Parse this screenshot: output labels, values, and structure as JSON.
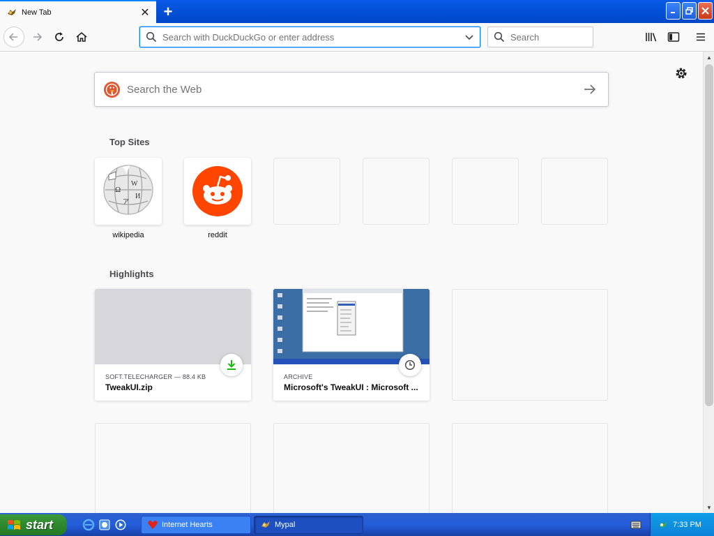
{
  "tab": {
    "title": "New Tab",
    "close_label": "✕",
    "new_tab_label": "+"
  },
  "window_controls": {
    "minimize": "_",
    "maximize": "▣",
    "close": "✕"
  },
  "navbar": {
    "url_placeholder": "Search with DuckDuckGo or enter address",
    "search_placeholder": "Search"
  },
  "newtab": {
    "search_placeholder": "Search the Web",
    "top_sites_title": "Top Sites",
    "top_sites": [
      {
        "label": "wikipedia",
        "icon": "wikipedia-globe-icon"
      },
      {
        "label": "reddit",
        "icon": "reddit-alien-icon"
      },
      {
        "label": ""
      },
      {
        "label": ""
      },
      {
        "label": ""
      },
      {
        "label": ""
      }
    ],
    "highlights_title": "Highlights",
    "highlights": [
      {
        "source": "SOFT.TELECHARGER — 88.4 KB",
        "title": "TweakUI.zip",
        "badge": "download-icon"
      },
      {
        "source": "ARCHIVE",
        "title": "Microsoft's TweakUI : Microsoft ...",
        "badge": "clock-icon"
      }
    ]
  },
  "taskbar": {
    "start_label": "start",
    "tasks": [
      {
        "label": "Internet Hearts",
        "icon": "hearts-icon"
      },
      {
        "label": "Mypal",
        "icon": "mypal-icon"
      }
    ],
    "clock": "7:33 PM"
  },
  "colors": {
    "accent": "#0a84ff",
    "reddit": "#ff4500",
    "download": "#12bc00",
    "xp_blue": "#245edb",
    "xp_green": "#2f8a2f"
  }
}
